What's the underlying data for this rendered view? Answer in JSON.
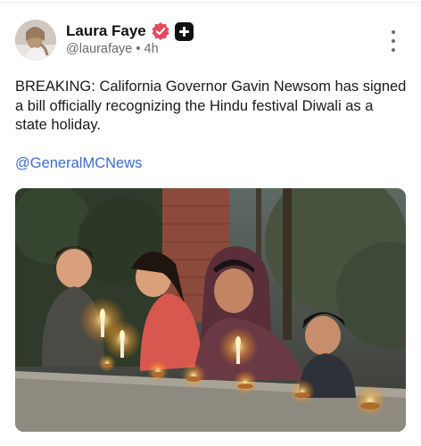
{
  "post": {
    "author": {
      "display_name": "Laura Faye",
      "handle": "@laurafaye",
      "verified_icon": "verified-badge-icon",
      "plus_icon": "plus-badge-icon"
    },
    "separator": "•",
    "timestamp": "4h",
    "body_text": "BREAKING: California Governor Gavin Newsom has signed a bill officially recognizing the Hindu festival Diwali as a state holiday.",
    "mention": "@GeneralMCNews",
    "media": {
      "kind": "photo",
      "subject": "family lighting diyas outdoors at dusk"
    },
    "menu_icon": "more-options-icon"
  },
  "colors": {
    "mention": "#3f6cc7",
    "verified": "#e8485d",
    "muted": "#6b6b6b"
  }
}
